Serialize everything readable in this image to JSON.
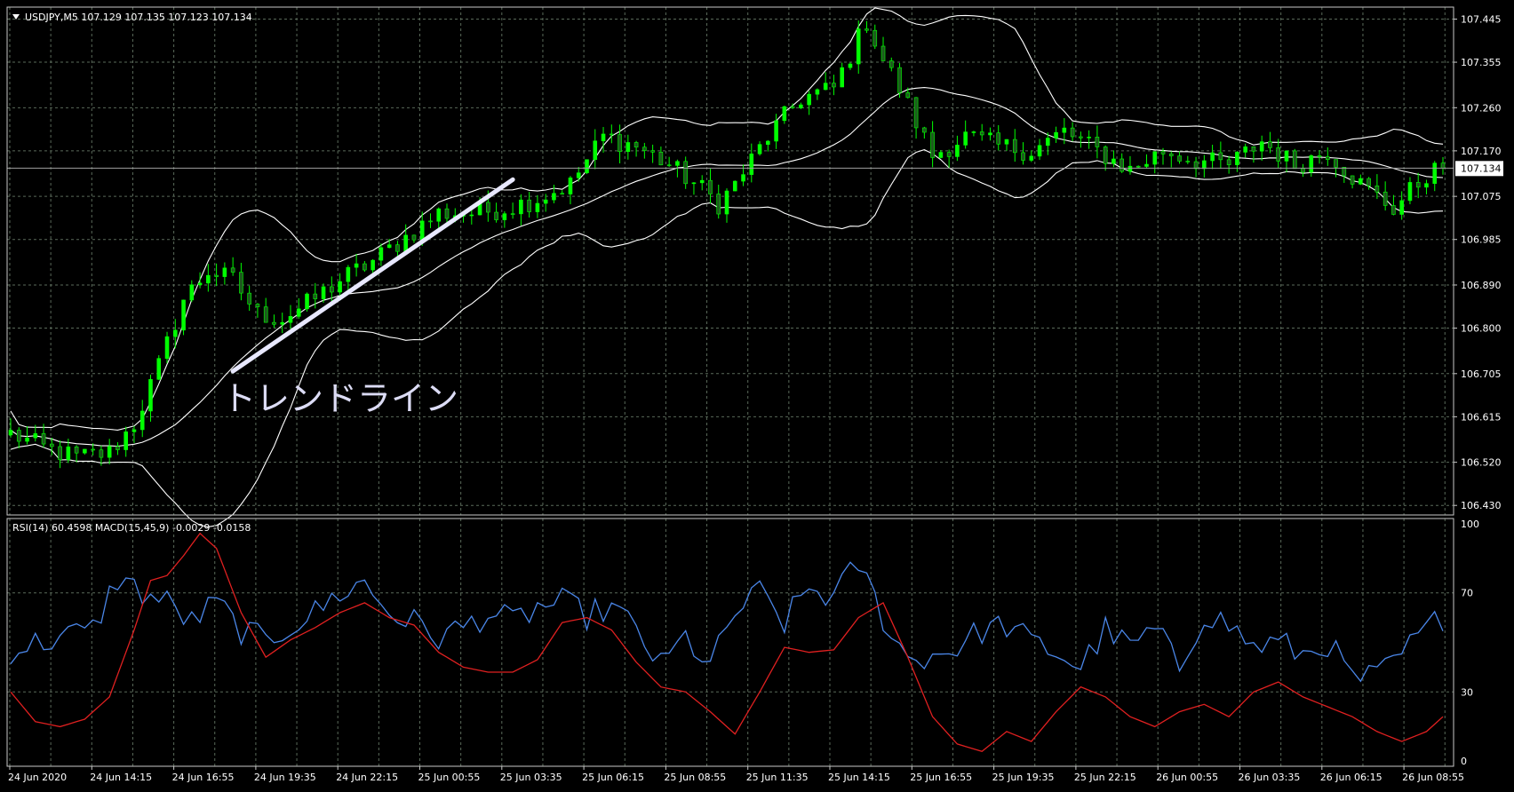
{
  "colors": {
    "background": "#000000",
    "grid": "#5a6a5a",
    "frame": "#c8c8c8",
    "candle_up": "#00ff00",
    "candle_down": "#1e5a1e",
    "bands": "#ffffff",
    "price_line": "#a0a0a0",
    "rsi": "#4a86e8",
    "macd": "#e02020",
    "trendline": "#e8e8ff",
    "annotation": "#dcdcf5"
  },
  "chart_data": [
    {
      "type": "candlestick",
      "header": "USDJPY,M5  107.129 107.135 107.123 107.134",
      "symbol_marker_icon": "triangle-down-icon",
      "current_price_label": "107.134",
      "current_price": 107.134,
      "ylim": [
        106.41,
        107.47
      ],
      "yticks": [
        "107.445",
        "107.355",
        "107.260",
        "107.170",
        "107.075",
        "106.985",
        "106.890",
        "106.800",
        "106.705",
        "106.615",
        "106.520",
        "106.430"
      ],
      "ytick_values": [
        107.445,
        107.355,
        107.26,
        107.17,
        107.075,
        106.985,
        106.89,
        106.8,
        106.705,
        106.615,
        106.52,
        106.43
      ],
      "xticks": [
        "24 Jun 2020",
        "24 Jun 14:15",
        "24 Jun 16:55",
        "24 Jun 19:35",
        "24 Jun 22:15",
        "25 Jun 00:55",
        "25 Jun 03:35",
        "25 Jun 06:15",
        "25 Jun 08:55",
        "25 Jun 11:35",
        "25 Jun 14:15",
        "25 Jun 16:55",
        "25 Jun 19:35",
        "25 Jun 22:15",
        "26 Jun 00:55",
        "26 Jun 03:35",
        "26 Jun 06:15",
        "26 Jun 08:55"
      ],
      "price_path": [
        [
          0,
          106.58
        ],
        [
          4,
          106.55
        ],
        [
          8,
          106.53
        ],
        [
          12,
          106.54
        ],
        [
          15,
          106.6
        ],
        [
          18,
          106.72
        ],
        [
          21,
          106.86
        ],
        [
          24,
          106.92
        ],
        [
          27,
          106.9
        ],
        [
          30,
          106.83
        ],
        [
          33,
          106.82
        ],
        [
          36,
          106.85
        ],
        [
          40,
          106.9
        ],
        [
          44,
          106.94
        ],
        [
          48,
          106.99
        ],
        [
          52,
          107.04
        ],
        [
          56,
          107.04
        ],
        [
          60,
          107.05
        ],
        [
          64,
          107.07
        ],
        [
          68,
          107.1
        ],
        [
          72,
          107.2
        ],
        [
          76,
          107.18
        ],
        [
          80,
          107.14
        ],
        [
          84,
          107.09
        ],
        [
          86,
          107.06
        ],
        [
          88,
          107.1
        ],
        [
          92,
          107.2
        ],
        [
          96,
          107.28
        ],
        [
          100,
          107.3
        ],
        [
          104,
          107.44
        ],
        [
          106,
          107.36
        ],
        [
          108,
          107.3
        ],
        [
          112,
          107.16
        ],
        [
          116,
          107.2
        ],
        [
          120,
          107.18
        ],
        [
          124,
          107.17
        ],
        [
          128,
          107.21
        ],
        [
          132,
          107.17
        ],
        [
          136,
          107.13
        ],
        [
          140,
          107.17
        ],
        [
          144,
          107.15
        ],
        [
          148,
          107.14
        ],
        [
          152,
          107.19
        ],
        [
          156,
          107.14
        ],
        [
          160,
          107.17
        ],
        [
          164,
          107.1
        ],
        [
          168,
          107.05
        ],
        [
          172,
          107.12
        ],
        [
          174,
          107.134
        ]
      ],
      "bands_note": "upper/lower envelope lines"
    },
    {
      "type": "line",
      "header": "RSI(14) 60.4598  MACD(15,45,9) -0.0029 -0.0158",
      "ylim": [
        0,
        100
      ],
      "yticks": [
        "100",
        "70",
        "30",
        "0"
      ],
      "ytick_values": [
        100,
        70,
        30,
        0
      ],
      "series": [
        {
          "name": "RSI(14)",
          "points": [
            [
              0,
              47
            ],
            [
              6,
              52
            ],
            [
              10,
              55
            ],
            [
              13,
              76
            ],
            [
              16,
              70
            ],
            [
              19,
              66
            ],
            [
              22,
              58
            ],
            [
              25,
              66
            ],
            [
              28,
              55
            ],
            [
              31,
              50
            ],
            [
              34,
              57
            ],
            [
              37,
              62
            ],
            [
              40,
              70
            ],
            [
              43,
              74
            ],
            [
              46,
              62
            ],
            [
              49,
              58
            ],
            [
              52,
              52
            ],
            [
              55,
              56
            ],
            [
              58,
              62
            ],
            [
              61,
              58
            ],
            [
              64,
              64
            ],
            [
              67,
              66
            ],
            [
              70,
              61
            ],
            [
              73,
              64
            ],
            [
              76,
              55
            ],
            [
              79,
              40
            ],
            [
              82,
              52
            ],
            [
              85,
              40
            ],
            [
              88,
              62
            ],
            [
              91,
              70
            ],
            [
              94,
              58
            ],
            [
              97,
              72
            ],
            [
              100,
              68
            ],
            [
              103,
              82
            ],
            [
              106,
              60
            ],
            [
              109,
              43
            ],
            [
              112,
              45
            ],
            [
              115,
              48
            ],
            [
              118,
              55
            ],
            [
              121,
              57
            ],
            [
              124,
              50
            ],
            [
              127,
              46
            ],
            [
              130,
              40
            ],
            [
              133,
              55
            ],
            [
              136,
              48
            ],
            [
              139,
              55
            ],
            [
              142,
              40
            ],
            [
              145,
              62
            ],
            [
              148,
              57
            ],
            [
              151,
              48
            ],
            [
              154,
              50
            ],
            [
              157,
              45
            ],
            [
              160,
              50
            ],
            [
              163,
              35
            ],
            [
              166,
              36
            ],
            [
              169,
              45
            ],
            [
              172,
              55
            ],
            [
              174,
              60.46
            ]
          ]
        },
        {
          "name": "MACD(15,45,9)",
          "points": [
            [
              0,
              30
            ],
            [
              3,
              18
            ],
            [
              6,
              16
            ],
            [
              9,
              19
            ],
            [
              12,
              28
            ],
            [
              15,
              55
            ],
            [
              17,
              75
            ],
            [
              19,
              77
            ],
            [
              21,
              85
            ],
            [
              23,
              94
            ],
            [
              25,
              88
            ],
            [
              28,
              62
            ],
            [
              31,
              44
            ],
            [
              34,
              51
            ],
            [
              37,
              56
            ],
            [
              40,
              62
            ],
            [
              43,
              66
            ],
            [
              46,
              60
            ],
            [
              49,
              57
            ],
            [
              52,
              46
            ],
            [
              55,
              40
            ],
            [
              58,
              38
            ],
            [
              61,
              38
            ],
            [
              64,
              43
            ],
            [
              67,
              58
            ],
            [
              70,
              60
            ],
            [
              73,
              55
            ],
            [
              76,
              42
            ],
            [
              79,
              32
            ],
            [
              82,
              30
            ],
            [
              85,
              22
            ],
            [
              88,
              13
            ],
            [
              91,
              30
            ],
            [
              94,
              48
            ],
            [
              97,
              46
            ],
            [
              100,
              47
            ],
            [
              103,
              60
            ],
            [
              106,
              66
            ],
            [
              109,
              44
            ],
            [
              112,
              20
            ],
            [
              115,
              9
            ],
            [
              118,
              6
            ],
            [
              121,
              14
            ],
            [
              124,
              10
            ],
            [
              127,
              22
            ],
            [
              130,
              32
            ],
            [
              133,
              28
            ],
            [
              136,
              20
            ],
            [
              139,
              16
            ],
            [
              142,
              22
            ],
            [
              145,
              25
            ],
            [
              148,
              20
            ],
            [
              151,
              30
            ],
            [
              154,
              34
            ],
            [
              157,
              28
            ],
            [
              160,
              24
            ],
            [
              163,
              20
            ],
            [
              166,
              14
            ],
            [
              169,
              10
            ],
            [
              172,
              14
            ],
            [
              174,
              20
            ]
          ]
        }
      ]
    }
  ],
  "annotation": {
    "label": "トレンドライン",
    "line": {
      "from": [
        27,
        106.71
      ],
      "to": [
        61,
        107.11
      ]
    }
  }
}
